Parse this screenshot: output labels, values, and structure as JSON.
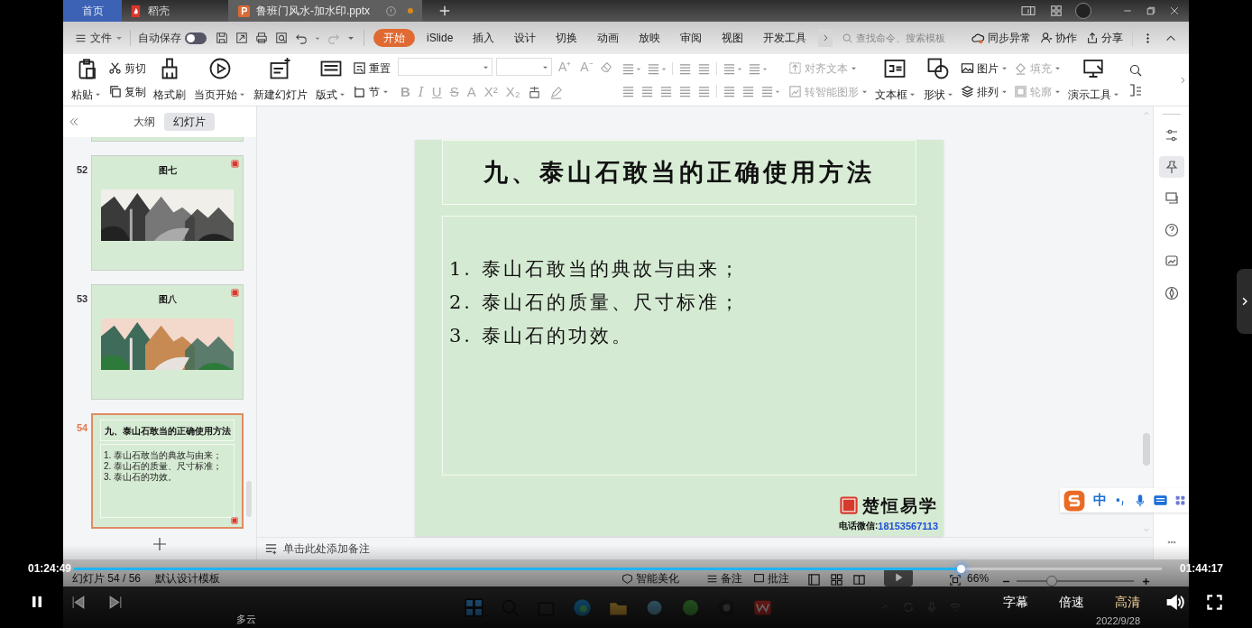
{
  "tabs": [
    {
      "label": "首页",
      "kind": "home",
      "selected": false
    },
    {
      "label": "稻壳",
      "kind": "app",
      "selected": false
    },
    {
      "label": "鲁班门风水-加水印.pptx",
      "kind": "doc",
      "selected": true,
      "unsaved": true
    }
  ],
  "menu": {
    "file": "文件",
    "autosave": {
      "label": "自动保存",
      "on": false
    },
    "tabs": [
      {
        "label": "开始",
        "selected": true
      },
      {
        "label": "iSlide",
        "selected": false
      },
      {
        "label": "插入",
        "selected": false
      },
      {
        "label": "设计",
        "selected": false
      },
      {
        "label": "切换",
        "selected": false
      },
      {
        "label": "动画",
        "selected": false
      },
      {
        "label": "放映",
        "selected": false
      },
      {
        "label": "审阅",
        "selected": false
      },
      {
        "label": "视图",
        "selected": false
      },
      {
        "label": "开发工具",
        "selected": false
      }
    ],
    "search": {
      "placeholder": "查找命令、搜索模板"
    },
    "actions": [
      "同步异常",
      "协作",
      "分享"
    ]
  },
  "ribbon": {
    "items": [
      {
        "kind": "big",
        "label": "粘贴",
        "dropdown": true,
        "disabled": false
      },
      {
        "kind": "small",
        "label": "剪切",
        "dropdown": false,
        "disabled": false
      },
      {
        "kind": "small",
        "label": "复制",
        "dropdown": false,
        "disabled": false
      },
      {
        "kind": "big",
        "label": "格式刷",
        "dropdown": false,
        "disabled": false
      },
      {
        "kind": "big",
        "label": "当页开始",
        "dropdown": true,
        "disabled": false
      },
      {
        "kind": "big",
        "label": "新建幻灯片",
        "dropdown": false,
        "disabled": false
      },
      {
        "kind": "big",
        "label": "版式",
        "dropdown": true,
        "disabled": false
      },
      {
        "kind": "small",
        "label": "重置",
        "dropdown": false,
        "disabled": false
      },
      {
        "kind": "small",
        "label": "节",
        "dropdown": true,
        "disabled": false
      },
      {
        "kind": "font"
      },
      {
        "kind": "paragraph"
      },
      {
        "kind": "small",
        "label": "对齐文本",
        "dropdown": true,
        "disabled": true
      },
      {
        "kind": "small",
        "label": "转智能图形",
        "dropdown": true,
        "disabled": true
      },
      {
        "kind": "big",
        "label": "文本框",
        "dropdown": true,
        "disabled": false
      },
      {
        "kind": "big",
        "label": "形状",
        "dropdown": true,
        "disabled": false
      },
      {
        "kind": "small",
        "label": "图片",
        "dropdown": true,
        "disabled": false
      },
      {
        "kind": "small",
        "label": "排列",
        "dropdown": true,
        "disabled": false
      },
      {
        "kind": "small",
        "label": "填充",
        "dropdown": true,
        "disabled": true
      },
      {
        "kind": "small",
        "label": "轮廓",
        "dropdown": true,
        "disabled": true
      },
      {
        "kind": "big",
        "label": "演示工具",
        "dropdown": true,
        "disabled": false
      }
    ],
    "size_buttons": [
      "A⁺",
      "A⁻"
    ],
    "format_buttons": [
      "B",
      "I",
      "U",
      "S",
      "A",
      "X²",
      "X₂"
    ]
  },
  "sidebar": {
    "tabs": [
      {
        "label": "大纲",
        "selected": false
      },
      {
        "label": "幻灯片",
        "selected": true
      }
    ],
    "slides": [
      {
        "number": "52",
        "kind": "picture",
        "title": "图七",
        "selected": false
      },
      {
        "number": "53",
        "kind": "picture",
        "title": "图八",
        "selected": false
      },
      {
        "number": "54",
        "kind": "text",
        "title": "九、泰山石敢当的正确使用方法",
        "items": [
          "1. 泰山石敢当的典故与由来；",
          "2. 泰山石的质量、尺寸标准；",
          "3. 泰山石的功效。"
        ],
        "selected": true
      }
    ]
  },
  "slide": {
    "title": "九、泰山石敢当的正确使用方法",
    "items": [
      "1. 泰山石敢当的典故与由来；",
      "2. 泰山石的质量、尺寸标准；",
      "3. 泰山石的功效。"
    ],
    "logo": {
      "name": "楚恒易学",
      "contact_label": "电话微信:",
      "contact_number": "18153567113"
    }
  },
  "ime": {
    "mode": "中"
  },
  "notes": {
    "placeholder": "单击此处添加备注"
  },
  "status": {
    "slide_counter": "幻灯片 54 / 56",
    "template": "默认设计模板",
    "beautify": "智能美化",
    "notes": "备注",
    "comments": "批注",
    "zoom": "66%",
    "zoom_slider": {
      "level": 0.3
    }
  },
  "taskbar": {
    "weather": "多云",
    "date": "2022/9/28"
  },
  "player": {
    "elapsed": "01:24:49",
    "duration": "01:44:17",
    "playing": true,
    "progress": {
      "level": 0.815
    },
    "options": [
      {
        "label": "字幕",
        "selected": false
      },
      {
        "label": "倍速",
        "selected": false
      },
      {
        "label": "高清",
        "selected": true
      }
    ]
  }
}
